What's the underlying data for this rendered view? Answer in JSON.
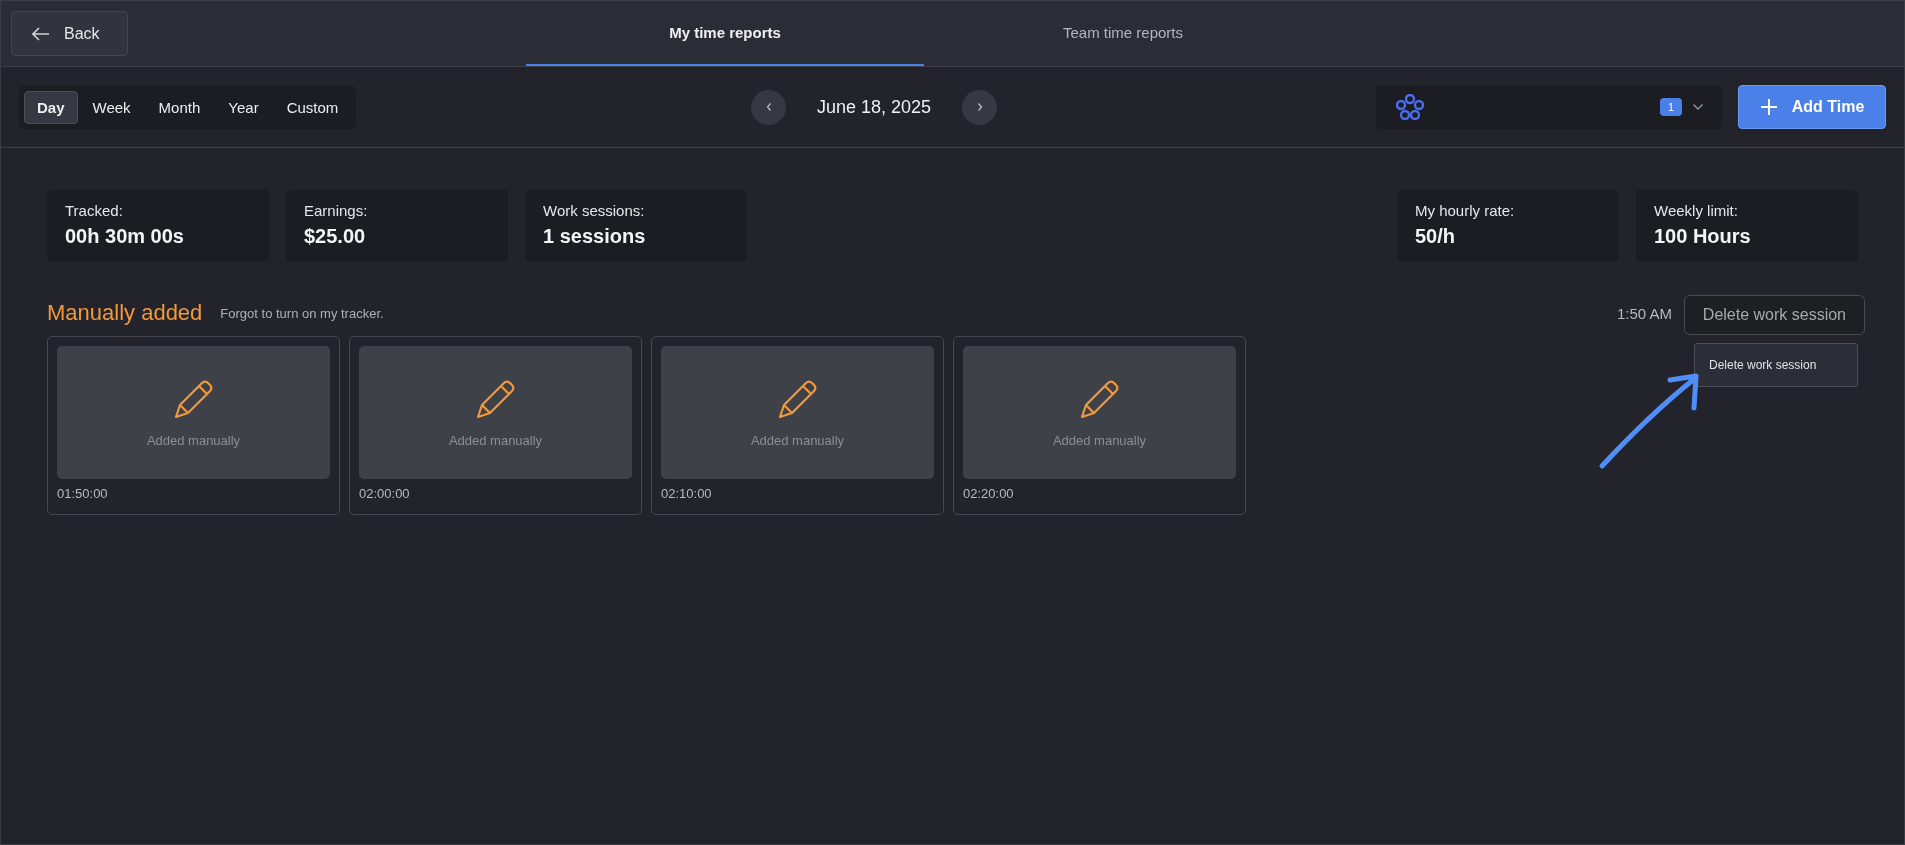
{
  "back_button": {
    "label": "Back"
  },
  "tabs": [
    {
      "label": "My time reports",
      "selected": true
    },
    {
      "label": "Team time reports",
      "selected": false
    }
  ],
  "periods": [
    {
      "label": "Day",
      "selected": true
    },
    {
      "label": "Week",
      "selected": false
    },
    {
      "label": "Month",
      "selected": false
    },
    {
      "label": "Year",
      "selected": false
    },
    {
      "label": "Custom",
      "selected": false
    }
  ],
  "date": "June 18, 2025",
  "project_select": {
    "count": "1"
  },
  "add_button": {
    "label": "Add Time"
  },
  "stats_left": [
    {
      "label": "Tracked:",
      "value": "00h 30m 00s"
    },
    {
      "label": "Earnings:",
      "value": "$25.00"
    },
    {
      "label": "Work sessions:",
      "value": "1 sessions"
    }
  ],
  "stats_right": [
    {
      "label": "My hourly rate:",
      "value": "50/h"
    },
    {
      "label": "Weekly limit:",
      "value": "100 Hours"
    }
  ],
  "session": {
    "title": "Manually added",
    "note": "Forgot to turn on my tracker.",
    "time_range": "1:50 AM",
    "tooltip": "Delete work session",
    "menu_items": [
      "Delete work session"
    ],
    "cards": [
      {
        "caption": "Added manually",
        "time": "01:50:00"
      },
      {
        "caption": "Added manually",
        "time": "02:00:00"
      },
      {
        "caption": "Added manually",
        "time": "02:10:00"
      },
      {
        "caption": "Added manually",
        "time": "02:20:00"
      }
    ]
  }
}
